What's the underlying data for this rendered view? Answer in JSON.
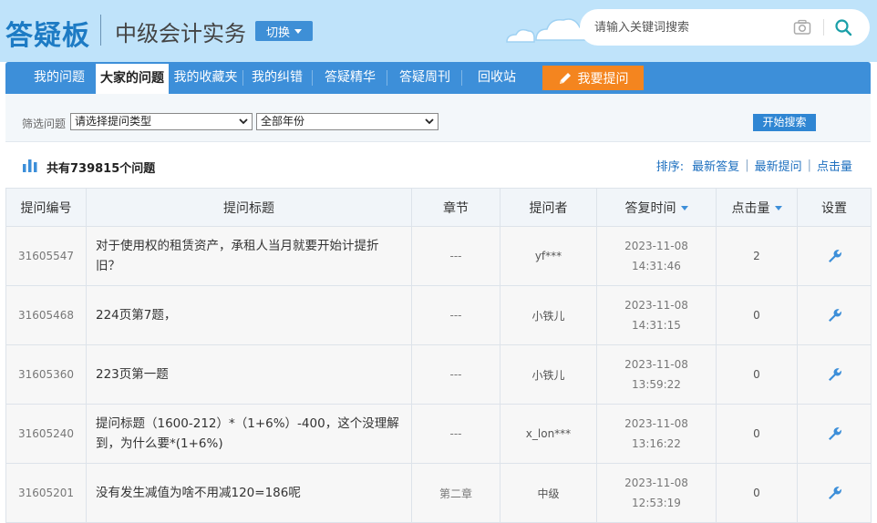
{
  "header": {
    "brand": "答疑板",
    "subject": "中级会计实务",
    "switch_label": "切换",
    "search_placeholder": "请输入关键词搜索"
  },
  "nav": {
    "items": [
      {
        "label": "我的问题"
      },
      {
        "label": "大家的问题",
        "active": true
      },
      {
        "label": "我的收藏夹"
      },
      {
        "label": "我的纠错"
      },
      {
        "label": "答疑精华"
      },
      {
        "label": "答疑周刊"
      },
      {
        "label": "回收站"
      }
    ],
    "ask_label": "我要提问"
  },
  "filter": {
    "label": "筛选问题",
    "type_select": "请选择提问类型",
    "year_select": "全部年份",
    "search_button": "开始搜索"
  },
  "summary": {
    "total_text": "共有739815个问题",
    "sort_label": "排序:",
    "sort_options": [
      "最新答复",
      "最新提问",
      "点击量"
    ]
  },
  "table": {
    "headers": [
      "提问编号",
      "提问标题",
      "章节",
      "提问者",
      "答复时间",
      "点击量",
      "设置"
    ],
    "rows": [
      {
        "id": "31605547",
        "title": "对于使用权的租赁资产，承租人当月就要开始计提折旧？",
        "chapter": "---",
        "asker": "yf***",
        "date": "2023-11-08",
        "time": "14:31:46",
        "clicks": "2"
      },
      {
        "id": "31605468",
        "title": "224页第7题，",
        "chapter": "---",
        "asker": "小铁儿",
        "date": "2023-11-08",
        "time": "14:31:15",
        "clicks": "0"
      },
      {
        "id": "31605360",
        "title": "223页第一题",
        "chapter": "---",
        "asker": "小铁儿",
        "date": "2023-11-08",
        "time": "13:59:22",
        "clicks": "0"
      },
      {
        "id": "31605240",
        "title": "提问标题（1600-212）*（1+6%）-400，这个没理解到，为什么要*(1+6%)",
        "chapter": "---",
        "asker": "x_lon***",
        "date": "2023-11-08",
        "time": "13:16:22",
        "clicks": "0"
      },
      {
        "id": "31605201",
        "title": "没有发生减值为啥不用减120=186呢",
        "chapter": "第二章",
        "asker": "中级",
        "date": "2023-11-08",
        "time": "12:53:19",
        "clicks": "0"
      }
    ]
  },
  "colors": {
    "header_bg": "#bfe3fa",
    "nav_bg": "#3d8fd9",
    "ask_btn": "#f4851f",
    "brand": "#1d7bc4"
  },
  "icons": [
    "camera-icon",
    "search-icon",
    "pencil-icon",
    "bar-chart-icon",
    "wrench-icon",
    "cloud-icon"
  ]
}
